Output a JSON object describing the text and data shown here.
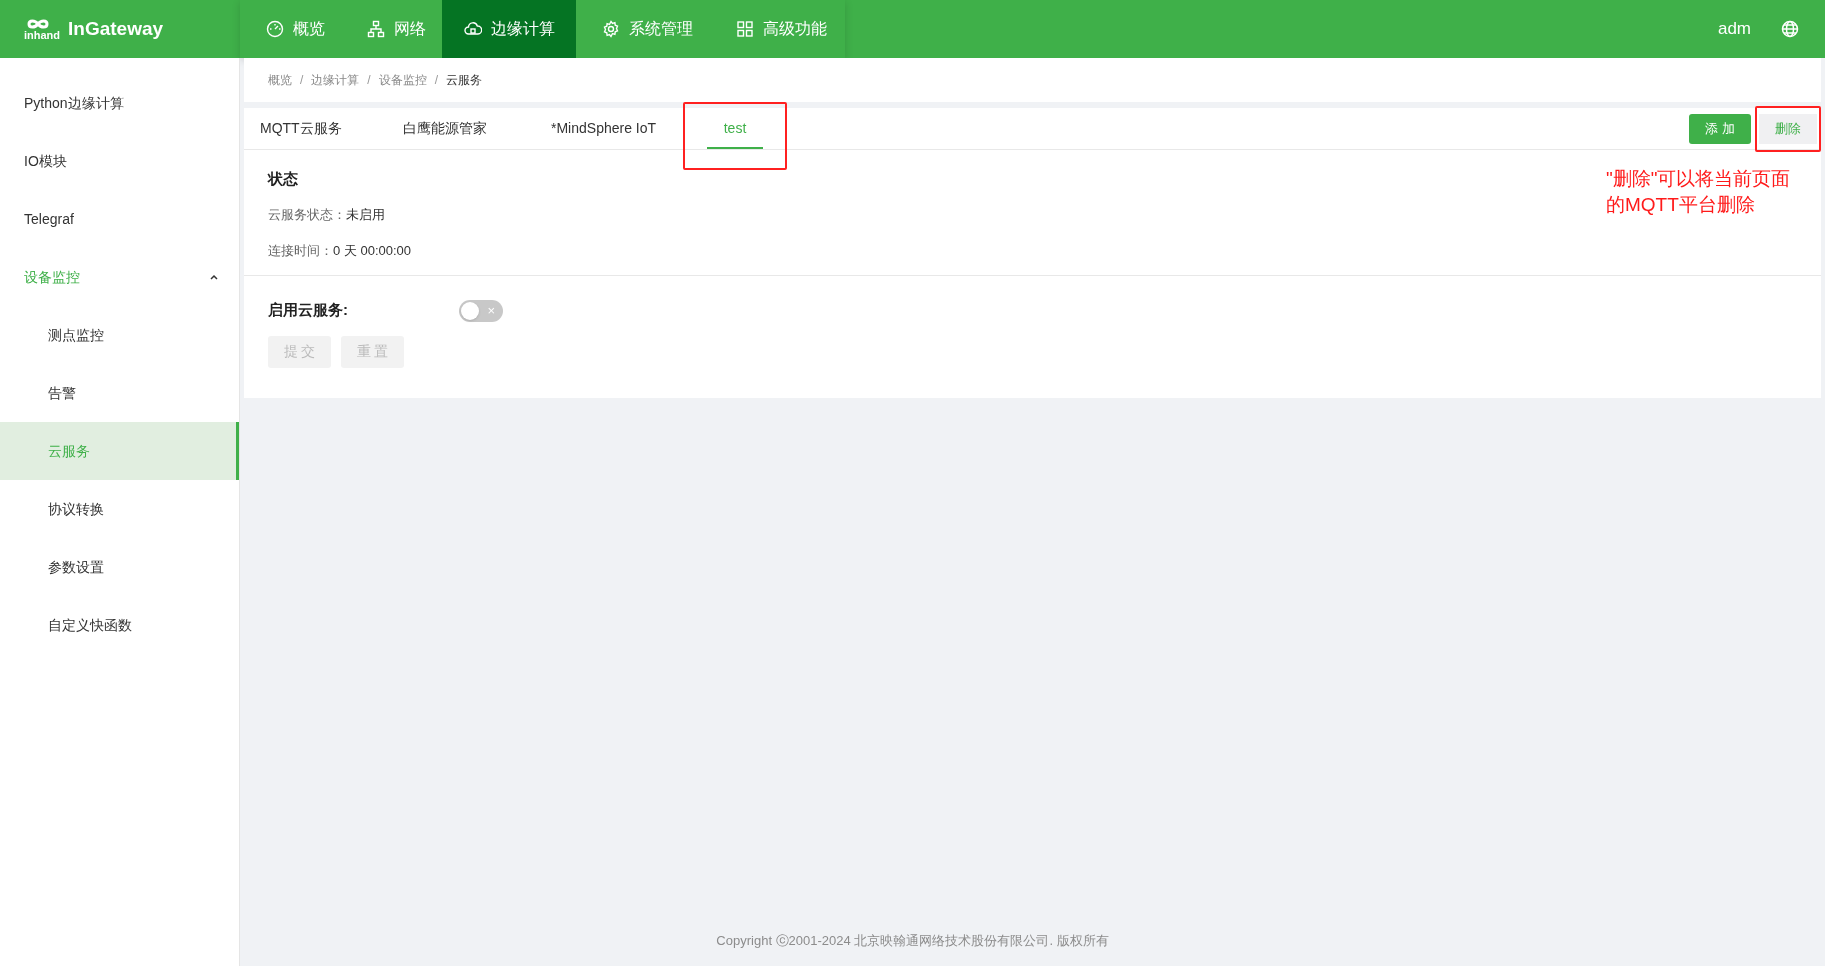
{
  "header": {
    "logo_small": "inhand",
    "logo": "InGateway",
    "nav": [
      {
        "label": "概览",
        "selected": false
      },
      {
        "label": "网络",
        "selected": false
      },
      {
        "label": "边缘计算",
        "selected": true
      },
      {
        "label": "系统管理",
        "selected": false
      },
      {
        "label": "高级功能",
        "selected": false
      }
    ],
    "user": "adm"
  },
  "sidebar": {
    "items": [
      {
        "label": "Python边缘计算",
        "selected": false
      },
      {
        "label": "IO模块",
        "selected": false
      },
      {
        "label": "Telegraf",
        "selected": false
      },
      {
        "label": "设备监控",
        "selected": true,
        "expanded": true,
        "children": [
          {
            "label": "测点监控",
            "selected": false
          },
          {
            "label": "告警",
            "selected": false
          },
          {
            "label": "云服务",
            "selected": true
          },
          {
            "label": "协议转换",
            "selected": false
          },
          {
            "label": "参数设置",
            "selected": false
          },
          {
            "label": "自定义快函数",
            "selected": false
          }
        ]
      }
    ]
  },
  "breadcrumb": {
    "separator": "/",
    "items": [
      "概览",
      "边缘计算",
      "设备监控",
      "云服务"
    ]
  },
  "tabs": [
    {
      "label": "MQTT云服务",
      "selected": false,
      "highlighted": false
    },
    {
      "label": "白鹰能源管家",
      "selected": false,
      "highlighted": false
    },
    {
      "label": "*MindSphere IoT",
      "selected": false,
      "highlighted": false
    },
    {
      "label": "test",
      "selected": true,
      "highlighted": true
    }
  ],
  "actions": [
    {
      "label": "添 加",
      "kind": "primary",
      "highlighted": false
    },
    {
      "label": "删除",
      "kind": "plain",
      "highlighted": true
    }
  ],
  "annotation": [
    "\"删除\"可以将当前页面",
    "的MQTT平台删除"
  ],
  "status": {
    "title": "状态",
    "rows": [
      {
        "label": "云服务状态：",
        "value": "未启用"
      },
      {
        "label": "连接时间：",
        "value": "0 天 00:00:00"
      }
    ]
  },
  "form": {
    "label": "启用云服务:",
    "switch_on": false,
    "toggle_glyph": "×",
    "buttons": [
      {
        "label": "提 交",
        "disabled": true
      },
      {
        "label": "重 置",
        "disabled": true
      }
    ]
  },
  "footer": "Copyright ⓒ2001-2024 北京映翰通网络技术股份有限公司. 版权所有"
}
